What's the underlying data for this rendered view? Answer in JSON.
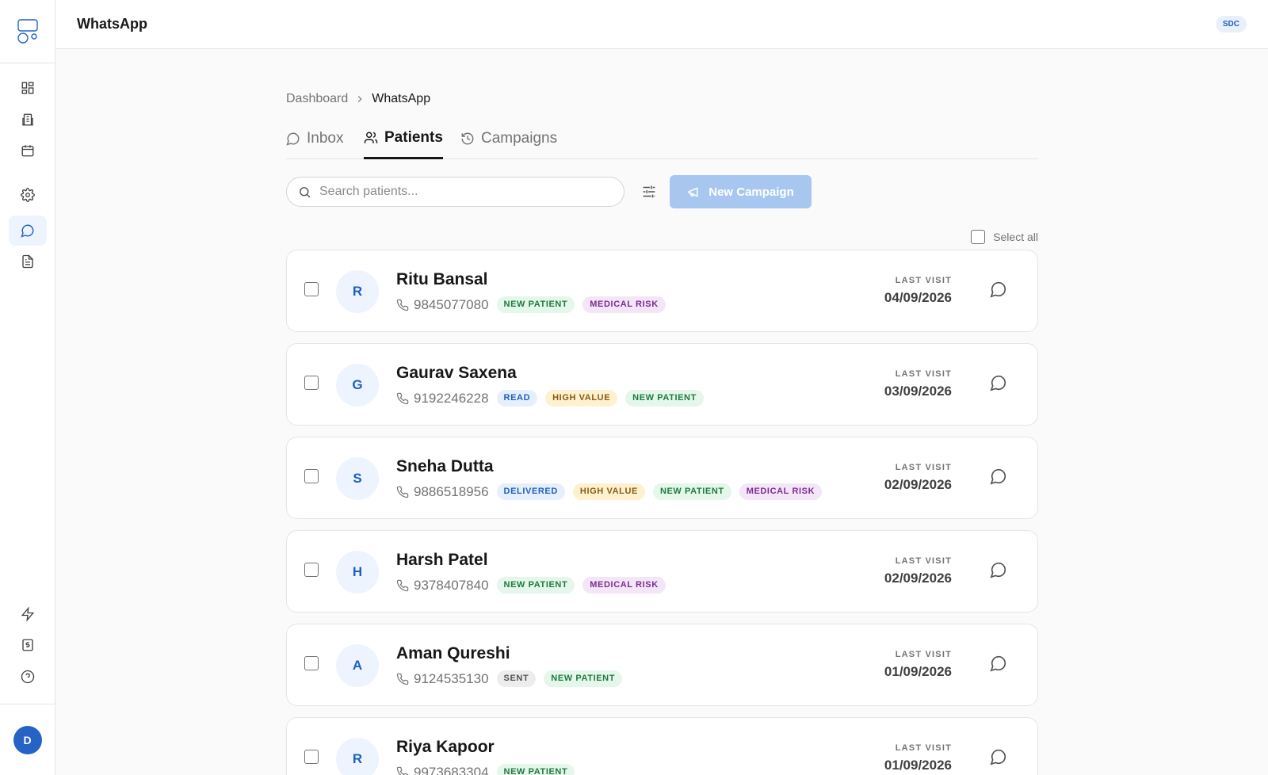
{
  "app": {
    "title": "WhatsApp",
    "badge": "SDC"
  },
  "sidebar": {
    "items": [
      {
        "icon": "dashboard-icon"
      },
      {
        "icon": "building-icon"
      },
      {
        "icon": "calendar-icon"
      },
      {
        "icon": "gear-icon"
      },
      {
        "icon": "message-icon",
        "active": true
      },
      {
        "icon": "document-icon"
      },
      {
        "icon": "lightning-icon"
      },
      {
        "icon": "billing-icon"
      },
      {
        "icon": "help-icon"
      }
    ],
    "user_initial": "D"
  },
  "breadcrumb": {
    "parent": "Dashboard",
    "current": "WhatsApp"
  },
  "tabs": [
    {
      "label": "Inbox",
      "icon": "chat-icon"
    },
    {
      "label": "Patients",
      "icon": "users-icon",
      "active": true
    },
    {
      "label": "Campaigns",
      "icon": "history-icon"
    }
  ],
  "search": {
    "placeholder": "Search patients..."
  },
  "actions": {
    "new_campaign": "New Campaign",
    "select_all": "Select all"
  },
  "last_visit_label": "LAST VISIT",
  "patients": [
    {
      "initial": "R",
      "name": "Ritu Bansal",
      "phone": "9845077080",
      "tags": [
        "NEW PATIENT",
        "MEDICAL RISK"
      ],
      "last_visit": "04/09/2026"
    },
    {
      "initial": "G",
      "name": "Gaurav Saxena",
      "phone": "9192246228",
      "tags": [
        "READ",
        "HIGH VALUE",
        "NEW PATIENT"
      ],
      "last_visit": "03/09/2026"
    },
    {
      "initial": "S",
      "name": "Sneha Dutta",
      "phone": "9886518956",
      "tags": [
        "DELIVERED",
        "HIGH VALUE",
        "NEW PATIENT",
        "MEDICAL RISK"
      ],
      "last_visit": "02/09/2026"
    },
    {
      "initial": "H",
      "name": "Harsh Patel",
      "phone": "9378407840",
      "tags": [
        "NEW PATIENT",
        "MEDICAL RISK"
      ],
      "last_visit": "02/09/2026"
    },
    {
      "initial": "A",
      "name": "Aman Qureshi",
      "phone": "9124535130",
      "tags": [
        "SENT",
        "NEW PATIENT"
      ],
      "last_visit": "01/09/2026"
    },
    {
      "initial": "R",
      "name": "Riya Kapoor",
      "phone": "9973683304",
      "tags": [
        "NEW PATIENT"
      ],
      "last_visit": "01/09/2026"
    }
  ],
  "tag_colors": {
    "NEW PATIENT": "#e4f7ea",
    "MEDICAL RISK": "#f3e6f7",
    "HIGH VALUE": "#fdf1cf",
    "READ": "#e6f0fc",
    "DELIVERED": "#e6f0fc",
    "SENT": "#ededed"
  },
  "colors": {
    "accent": "#2563c7",
    "button_disabled": "#a8c7f0"
  }
}
